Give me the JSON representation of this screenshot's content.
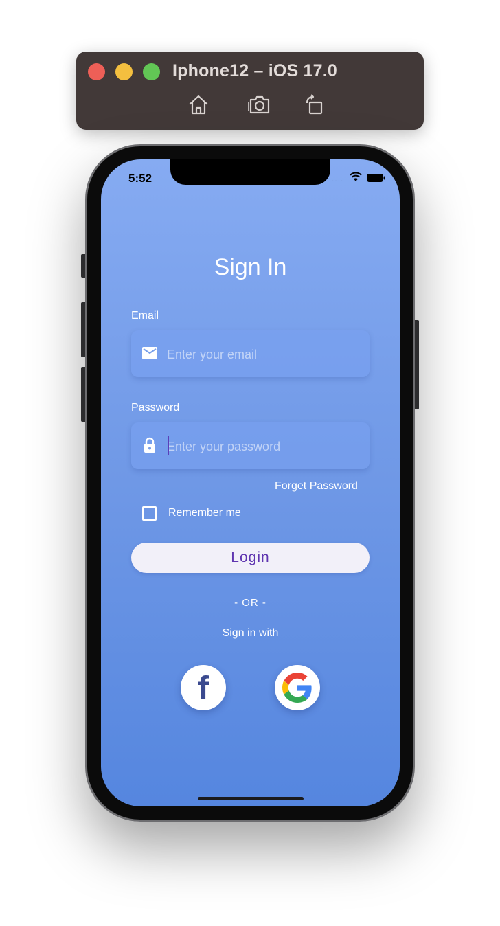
{
  "simulator": {
    "title": "Iphone12 – iOS 17.0",
    "buttons": [
      "home-icon",
      "screenshot-icon",
      "rotate-icon"
    ]
  },
  "status_bar": {
    "time": "5:52"
  },
  "sign_in": {
    "title": "Sign In",
    "email_label": "Email",
    "email_placeholder": "Enter your email",
    "email_icon": "mail-icon",
    "password_label": "Password",
    "password_placeholder": "Enter your password",
    "password_icon": "lock-icon",
    "forgot_label": "Forget Password",
    "remember_label": "Remember me",
    "remember_checked": false,
    "login_label": "Login",
    "or_text": "- OR -",
    "signin_with_label": "Sign in with",
    "social": [
      {
        "name": "facebook",
        "glyph": "f"
      },
      {
        "name": "google"
      }
    ]
  },
  "colors": {
    "accent": "#5f35b0",
    "screen_top": "#86abf2",
    "screen_bottom": "#5586df",
    "sim_bar": "#423938"
  }
}
